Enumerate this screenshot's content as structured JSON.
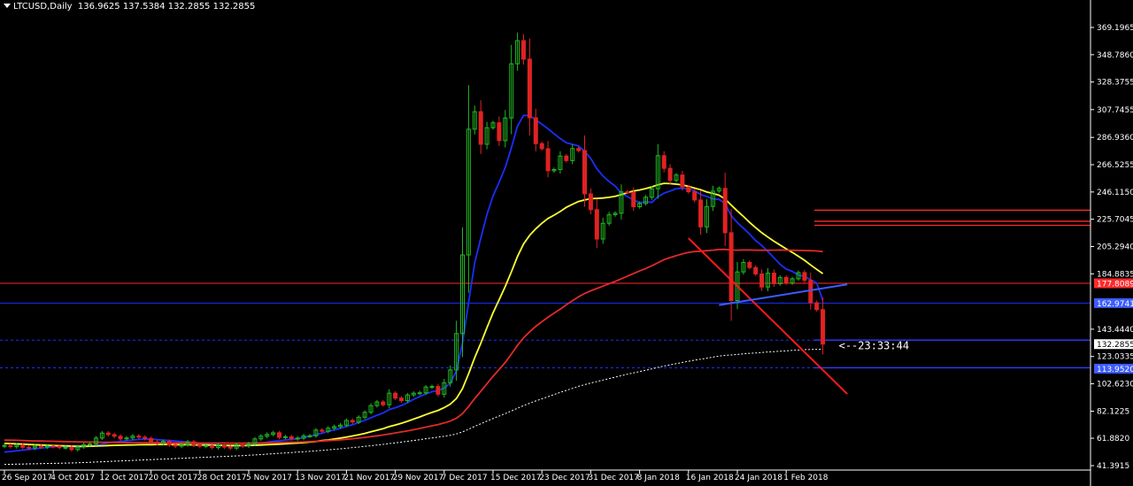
{
  "header": {
    "symbol": "LTCUSD,Daily",
    "ohlc": "136.9625 137.5384 132.2855 132.2855"
  },
  "countdown": "<--23:33:44",
  "chart_data": {
    "type": "candlestick",
    "symbol": "LTCUSD",
    "timeframe": "Daily",
    "y_ticks": [
      "369.1965",
      "348.7860",
      "328.3755",
      "307.7455",
      "286.9360",
      "266.5255",
      "246.1150",
      "225.7045",
      "205.2940",
      "184.8835",
      "143.4440",
      "123.0335",
      "102.6230",
      "82.1225",
      "61.8820",
      "41.3915"
    ],
    "y_range": [
      41.3915,
      369.1965
    ],
    "x_ticks": [
      "26 Sep 2017",
      "4 Oct 2017",
      "12 Oct 2017",
      "20 Oct 2017",
      "28 Oct 2017",
      "5 Nov 2017",
      "13 Nov 2017",
      "21 Nov 2017",
      "29 Nov 2017",
      "7 Dec 2017",
      "15 Dec 2017",
      "23 Dec 2017",
      "31 Dec 2017",
      "8 Jan 2018",
      "16 Jan 2018",
      "24 Jan 2018",
      "1 Feb 2018"
    ],
    "price_tags": [
      {
        "label": "177.8089",
        "value": 177.8089,
        "color": "#ff2a2a"
      },
      {
        "label": "162.9741",
        "value": 162.9741,
        "color": "#3d5cff"
      },
      {
        "label": "132.2855",
        "value": 132.2855,
        "color": "#ffffff"
      },
      {
        "label": "113.9520",
        "value": 113.952,
        "color": "#3d5cff"
      }
    ],
    "horizontal_levels": [
      {
        "value": 177.8,
        "color": "#ff2a2a",
        "style": "solid",
        "extent": "full"
      },
      {
        "value": 162.97,
        "color": "#1a2fff",
        "style": "solid",
        "extent": "full"
      },
      {
        "value": 135.3,
        "color": "#1a2fff",
        "style": "dashed",
        "extent": "full"
      },
      {
        "value": 135.3,
        "color": "#2a3dff",
        "style": "solid",
        "extent": "right"
      },
      {
        "value": 114.6,
        "color": "#1a2fff",
        "style": "dashed",
        "extent": "full"
      },
      {
        "value": 114.6,
        "color": "#2a3dff",
        "style": "solid",
        "extent": "right"
      },
      {
        "value": 232.5,
        "color": "#ff2a2a",
        "style": "solid",
        "extent": "right"
      },
      {
        "value": 224.2,
        "color": "#ff2a2a",
        "style": "solid",
        "extent": "right"
      },
      {
        "value": 221.2,
        "color": "#ff2a2a",
        "style": "solid",
        "extent": "right"
      }
    ],
    "trendlines": [
      {
        "from": [
          "2018-01-16",
          211.5
        ],
        "to": [
          "2018-02-11",
          95.0
        ],
        "color": "#ff1a1a"
      },
      {
        "from": [
          "2018-01-21",
          161.5
        ],
        "to": [
          "2018-02-11",
          177.0
        ],
        "color": "#3d5cff"
      }
    ],
    "close_series": {
      "dates_start": "2017-09-26",
      "values": [
        56.5,
        55.6,
        56.8,
        55.1,
        54.6,
        55.9,
        55.3,
        56.0,
        55.8,
        54.9,
        55.1,
        53.4,
        55.4,
        57.1,
        57.6,
        62.0,
        65.8,
        64.6,
        63.4,
        61.4,
        62.1,
        63.5,
        62.7,
        61.7,
        59.0,
        57.9,
        59.5,
        56.8,
        56.0,
        57.1,
        59.2,
        56.9,
        55.9,
        56.4,
        55.0,
        56.8,
        55.3,
        54.5,
        57.1,
        56.1,
        57.8,
        61.4,
        63.4,
        64.8,
        66.0,
        62.6,
        63.0,
        61.6,
        62.0,
        63.7,
        63.7,
        68.0,
        67.1,
        69.4,
        70.6,
        71.7,
        75.2,
        74.0,
        77.6,
        81.3,
        86.3,
        89.0,
        86.9,
        95.6,
        91.9,
        90.0,
        94.3,
        95.6,
        95.9,
        100.2,
        100.6,
        94.8,
        103.4,
        113.0,
        140.2,
        199.0,
        293.1,
        306.2,
        281.8,
        294.2,
        297.9,
        284.5,
        301.5,
        342.0,
        359.3,
        345.5,
        301.6,
        282.3,
        278.5,
        262.0,
        262.9,
        273.0,
        269.6,
        278.6,
        277.1,
        244.7,
        232.9,
        210.9,
        222.7,
        229.1,
        230.2,
        246.2,
        245.9,
        235.1,
        237.5,
        242.2,
        248.5,
        273.3,
        263.8,
        254.8,
        258.8,
        249.8,
        246.3,
        240.1,
        220.0,
        235.3,
        246.8,
        248.8,
        215.6,
        164.9,
        186.3,
        193.4,
        189.6,
        184.8,
        175.0,
        185.4,
        177.5,
        182.2,
        178.1,
        181.2,
        185.8,
        180.0,
        163.2,
        158.1,
        132.3
      ]
    },
    "moving_averages": [
      {
        "name": "blue",
        "color": "#1a2fff",
        "values": [
          51.5,
          52.0,
          52.5,
          53.0,
          53.5,
          54.0,
          54.5,
          55.0,
          55.5,
          56.0,
          55.7,
          55.4,
          55.2,
          55.5,
          56.0,
          56.5,
          57.5,
          58.4,
          59.0,
          59.5,
          60.0,
          60.5,
          61.0,
          61.2,
          61.3,
          60.8,
          60.5,
          60.2,
          59.8,
          59.4,
          59.0,
          58.7,
          58.3,
          57.9,
          57.4,
          57.0,
          56.6,
          56.5,
          56.4,
          56.3,
          56.5,
          57.3,
          58.1,
          58.9,
          59.6,
          60.0,
          60.6,
          61.0,
          61.5,
          62.4,
          63.3,
          64.6,
          65.6,
          67.0,
          68.0,
          69.3,
          70.7,
          72.0,
          73.6,
          75.3,
          77.2,
          79.1,
          80.8,
          83.4,
          84.7,
          86.4,
          88.4,
          91.0,
          93.1,
          95.0,
          96.7,
          97.5,
          99.4,
          103.1,
          112.2,
          133.2,
          163.5,
          193.2,
          211.6,
          229.2,
          243.1,
          253.4,
          264.4,
          279.0,
          295.4,
          303.4,
          303.4,
          300.0,
          296.8,
          293.4,
          289.6,
          286.1,
          282.9,
          281.8,
          280.5,
          276.6,
          271.2,
          263.5,
          258.1,
          254.0,
          250.5,
          245.2,
          242.7,
          240.2,
          238.1,
          238.8,
          238.3,
          242.6,
          245.2,
          246.8,
          248.6,
          248.9,
          248.5,
          247.0,
          244.2,
          242.7,
          241.0,
          240.6,
          237.5,
          228.4,
          223.2,
          219.0,
          214.6,
          209.8,
          206.1,
          201.6,
          196.9,
          192.0,
          188.5,
          186.7,
          184.0,
          183.0,
          180.5,
          178.0,
          165.0
        ]
      },
      {
        "name": "yellow",
        "color": "#ffff33",
        "values": [
          58.0,
          57.9,
          57.7,
          57.5,
          57.2,
          57.0,
          56.8,
          56.6,
          56.4,
          56.3,
          56.2,
          56.0,
          55.9,
          55.8,
          55.9,
          56.0,
          56.2,
          56.4,
          56.6,
          56.7,
          56.8,
          56.9,
          57.0,
          57.1,
          57.1,
          57.2,
          57.3,
          57.2,
          57.1,
          57.1,
          57.0,
          56.9,
          56.8,
          56.8,
          56.7,
          56.6,
          56.5,
          56.4,
          56.4,
          56.4,
          56.5,
          56.6,
          56.8,
          57.0,
          57.3,
          57.5,
          57.7,
          58.0,
          58.3,
          58.6,
          59.0,
          59.5,
          60.1,
          60.6,
          61.3,
          62.0,
          62.8,
          63.6,
          64.5,
          65.5,
          66.7,
          67.9,
          69.1,
          70.6,
          71.8,
          73.1,
          74.6,
          76.2,
          77.8,
          79.6,
          81.2,
          82.7,
          84.8,
          87.4,
          91.6,
          99.0,
          110.1,
          122.2,
          133.0,
          144.6,
          155.7,
          165.5,
          175.4,
          186.3,
          197.8,
          207.2,
          213.7,
          218.6,
          222.7,
          226.3,
          228.8,
          231.5,
          234.6,
          236.9,
          239.0,
          240.1,
          241.1,
          241.3,
          241.6,
          242.1,
          242.9,
          244.1,
          245.6,
          246.8,
          247.6,
          248.7,
          249.9,
          251.5,
          252.6,
          252.4,
          252.0,
          251.4,
          250.3,
          249.0,
          247.8,
          246.1,
          245.0,
          243.7,
          240.8,
          236.3,
          231.9,
          227.8,
          223.4,
          219.4,
          215.6,
          212.4,
          209.3,
          206.4,
          203.6,
          200.9,
          198.0,
          195.0,
          191.5,
          188.2,
          185.0
        ]
      },
      {
        "name": "red",
        "color": "#e02a2a",
        "values": [
          60.5,
          60.4,
          60.3,
          60.2,
          60.0,
          59.9,
          59.8,
          59.7,
          59.6,
          59.5,
          59.4,
          59.3,
          59.2,
          59.1,
          59.0,
          59.0,
          58.9,
          58.8,
          58.8,
          58.7,
          58.7,
          58.6,
          58.6,
          58.6,
          58.5,
          58.5,
          58.5,
          58.4,
          58.4,
          58.4,
          58.4,
          58.3,
          58.3,
          58.3,
          58.3,
          58.3,
          58.3,
          58.2,
          58.2,
          58.2,
          58.3,
          58.3,
          58.4,
          58.5,
          58.6,
          58.7,
          58.8,
          58.9,
          59.0,
          59.2,
          59.4,
          59.6,
          59.8,
          60.1,
          60.4,
          60.7,
          61.1,
          61.5,
          62.0,
          62.5,
          63.1,
          63.7,
          64.3,
          65.1,
          65.8,
          66.6,
          67.4,
          68.3,
          69.2,
          70.2,
          71.2,
          72.1,
          73.3,
          74.7,
          76.8,
          80.3,
          85.6,
          91.6,
          97.0,
          102.6,
          108.2,
          113.3,
          118.6,
          124.8,
          131.3,
          137.0,
          141.5,
          145.6,
          149.1,
          152.4,
          155.4,
          158.5,
          161.7,
          164.7,
          167.7,
          170.1,
          172.2,
          173.9,
          175.7,
          177.5,
          179.2,
          181.2,
          183.2,
          185.1,
          187.0,
          188.9,
          190.9,
          193.2,
          195.5,
          197.0,
          198.5,
          199.8,
          200.9,
          201.6,
          201.8,
          202.2,
          202.6,
          203.1,
          203.2,
          202.7,
          202.6,
          202.7,
          202.7,
          202.6,
          202.5,
          202.6,
          202.6,
          202.7,
          202.6,
          202.5,
          202.4,
          202.3,
          202.2,
          202.0,
          201.5
        ]
      },
      {
        "name": "white-dotted",
        "color": "#ffffff",
        "style": "dotted",
        "values": [
          42.3,
          42.4,
          42.5,
          42.6,
          42.7,
          42.8,
          42.9,
          43.0,
          43.1,
          43.2,
          43.3,
          43.4,
          43.6,
          43.7,
          43.9,
          44.1,
          44.3,
          44.5,
          44.7,
          44.9,
          45.1,
          45.3,
          45.5,
          45.7,
          45.9,
          46.1,
          46.3,
          46.5,
          46.7,
          46.9,
          47.1,
          47.3,
          47.5,
          47.7,
          47.9,
          48.1,
          48.3,
          48.5,
          48.7,
          48.9,
          49.2,
          49.4,
          49.7,
          50.0,
          50.3,
          50.6,
          50.9,
          51.2,
          51.5,
          51.8,
          52.1,
          52.5,
          52.8,
          53.2,
          53.6,
          54.0,
          54.4,
          54.9,
          55.3,
          55.8,
          56.3,
          56.8,
          57.3,
          57.9,
          58.4,
          59.0,
          59.6,
          60.2,
          60.8,
          61.5,
          62.1,
          62.7,
          63.4,
          64.1,
          65.1,
          66.6,
          68.6,
          70.8,
          72.7,
          74.7,
          76.6,
          78.5,
          80.3,
          82.3,
          84.3,
          86.3,
          88.1,
          89.8,
          91.4,
          93.0,
          94.6,
          96.2,
          97.7,
          99.2,
          100.7,
          102.0,
          103.2,
          104.3,
          105.4,
          106.5,
          107.6,
          108.7,
          109.8,
          110.8,
          111.8,
          112.8,
          113.8,
          114.9,
          115.9,
          116.8,
          117.7,
          118.6,
          119.5,
          120.3,
          121.0,
          121.8,
          122.6,
          123.4,
          123.9,
          124.2,
          124.6,
          125.0,
          125.4,
          125.7,
          126.0,
          126.4,
          126.7,
          127.0,
          127.3,
          127.6,
          127.9,
          128.2,
          128.3,
          128.4,
          128.5
        ]
      }
    ]
  }
}
